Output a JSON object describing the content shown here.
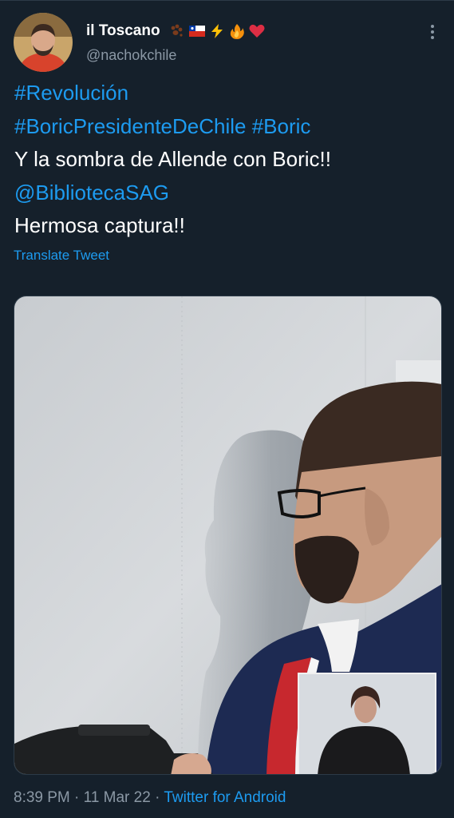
{
  "tweet": {
    "author": {
      "display_name": "il Toscano",
      "handle": "@nachokchile",
      "emoji_icons": [
        "paw-prints-icon",
        "chile-flag-icon",
        "lightning-icon",
        "fire-icon",
        "heart-icon"
      ]
    },
    "text_lines": [
      {
        "text": "#Revolución",
        "kind": "hashtag"
      },
      {
        "parts": [
          {
            "text": "#BoricPresidenteDeChile",
            "kind": "hashtag"
          },
          {
            "text": " ",
            "kind": "plain"
          },
          {
            "text": "#Boric",
            "kind": "hashtag"
          }
        ]
      },
      {
        "text": "Y la sombra de Allende con Boric!!",
        "kind": "plain"
      },
      {
        "text": "@BibliotecaSAG",
        "kind": "mention"
      },
      {
        "text": "Hermosa captura!!",
        "kind": "plain"
      }
    ],
    "translate_label": "Translate Tweet",
    "time": "8:39 PM",
    "separator": "·",
    "date": "11 Mar 22",
    "source": "Twitter for Android"
  },
  "colors": {
    "background": "#15202b",
    "link": "#1d9bf0",
    "secondary_text": "#8b98a5",
    "primary_text": "#ffffff"
  }
}
